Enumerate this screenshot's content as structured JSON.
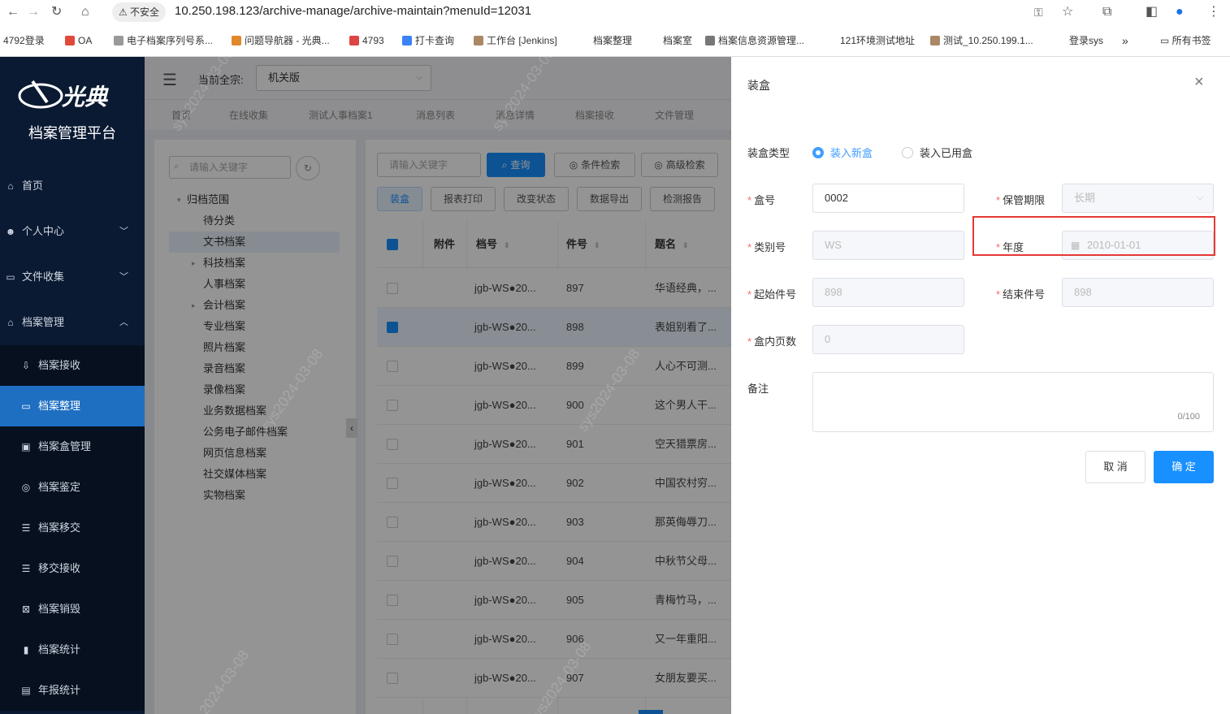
{
  "browser": {
    "security": "不安全",
    "url": "10.250.198.123/archive-manage/archive-maintain?menuId=12031",
    "bookmarks": [
      "4792登录",
      "OA",
      "电子档案序列号系...",
      "问题导航器 - 光典...",
      "4793",
      "打卡查询",
      "工作台 [Jenkins]",
      "档案整理",
      "档案室",
      "档案信息资源管理...",
      "121环境测试地址",
      "测试_10.250.199.1...",
      "登录sys",
      "所有书签"
    ]
  },
  "app": {
    "logo": "光典",
    "platform": "档案管理平台"
  },
  "sidebar": [
    {
      "label": "首页",
      "icon": "home-icon"
    },
    {
      "label": "个人中心",
      "icon": "user-icon"
    },
    {
      "label": "文件收集",
      "icon": "folder-icon"
    },
    {
      "label": "档案管理",
      "icon": "bank-icon"
    },
    {
      "label": "档案接收",
      "icon": "receive-icon"
    },
    {
      "label": "档案整理",
      "icon": "folder-icon"
    },
    {
      "label": "档案盒管理",
      "icon": "box-icon"
    },
    {
      "label": "档案鉴定",
      "icon": "appraise-icon"
    },
    {
      "label": "档案移交",
      "icon": "list-icon"
    },
    {
      "label": "移交接收",
      "icon": "list-icon"
    },
    {
      "label": "档案销毁",
      "icon": "destroy-icon"
    },
    {
      "label": "档案统计",
      "icon": "chart-icon"
    },
    {
      "label": "年报统计",
      "icon": "report-icon"
    }
  ],
  "topbar": {
    "fonds_label": "当前全宗:",
    "fonds_value": "机关版"
  },
  "tabs": [
    "首页",
    "在线收集",
    "测试人事档案1",
    "消息列表",
    "消息详情",
    "档案接收",
    "文件管理"
  ],
  "tree": {
    "search_placeholder": "请输入关键字",
    "nodes": [
      "归档范围",
      "待分类",
      "文书档案",
      "科技档案",
      "人事档案",
      "会计档案",
      "专业档案",
      "照片档案",
      "录音档案",
      "录像档案",
      "业务数据档案",
      "公务电子邮件档案",
      "网页信息档案",
      "社交媒体档案",
      "实物档案"
    ]
  },
  "grid": {
    "search_placeholder": "请输入关键字",
    "buttons": [
      "查询",
      "条件检索",
      "高级检索",
      "装盒",
      "报表打印",
      "改变状态",
      "数据导出",
      "检测报告"
    ],
    "headers": [
      "附件",
      "档号",
      "件号",
      "题名"
    ],
    "rows": [
      {
        "dh": "jgb-WS●20...",
        "jh": "897",
        "tm": "华语经典，..."
      },
      {
        "dh": "jgb-WS●20...",
        "jh": "898",
        "tm": "表姐别看了..."
      },
      {
        "dh": "jgb-WS●20...",
        "jh": "899",
        "tm": "人心不可测..."
      },
      {
        "dh": "jgb-WS●20...",
        "jh": "900",
        "tm": "这个男人干..."
      },
      {
        "dh": "jgb-WS●20...",
        "jh": "901",
        "tm": "空天猎票房..."
      },
      {
        "dh": "jgb-WS●20...",
        "jh": "902",
        "tm": "中国农村穷..."
      },
      {
        "dh": "jgb-WS●20...",
        "jh": "903",
        "tm": "那英侮辱刀..."
      },
      {
        "dh": "jgb-WS●20...",
        "jh": "904",
        "tm": "中秋节父母..."
      },
      {
        "dh": "jgb-WS●20...",
        "jh": "905",
        "tm": "青梅竹马，..."
      },
      {
        "dh": "jgb-WS●20...",
        "jh": "906",
        "tm": "又一年重阳..."
      },
      {
        "dh": "jgb-WS●20...",
        "jh": "907",
        "tm": "女朋友要买..."
      }
    ]
  },
  "watermark": [
    "sys2024-03-08",
    "sys2024-03-08",
    "sys2024-03-08",
    "sys2024-03-08",
    "2024-03-08",
    "sys2024-03-08"
  ],
  "drawer": {
    "title": "装盒",
    "box_type_label": "装盒类型",
    "opt_new": "装入新盒",
    "opt_used": "装入已用盒",
    "box_no_label": "盒号",
    "box_no": "0002",
    "retention_label": "保管期限",
    "retention": "长期",
    "category_label": "类别号",
    "category": "WS",
    "year_label": "年度",
    "year": "2010-01-01",
    "start_label": "起始件号",
    "start": "898",
    "end_label": "结束件号",
    "end": "898",
    "pages_label": "盒内页数",
    "pages": "0",
    "remark_label": "备注",
    "counter": "0/100",
    "cancel": "取 消",
    "ok": "确 定"
  }
}
